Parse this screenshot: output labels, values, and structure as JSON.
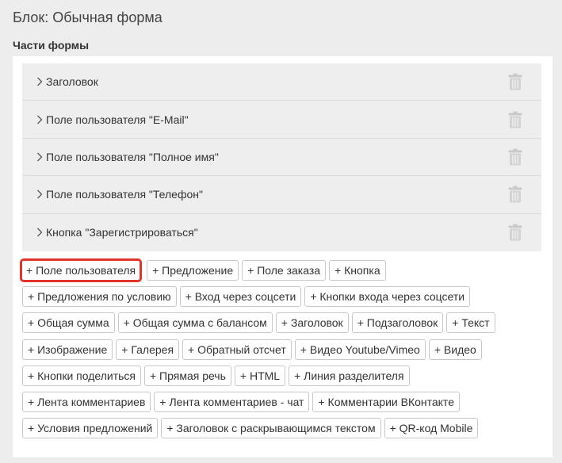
{
  "header": {
    "block_title": "Блок: Обычная форма",
    "section_title": "Части формы"
  },
  "parts": [
    {
      "label": "Заголовок"
    },
    {
      "label": "Поле пользователя \"E-Mail\""
    },
    {
      "label": "Поле пользователя \"Полное имя\""
    },
    {
      "label": "Поле пользователя \"Телефон\""
    },
    {
      "label": "Кнопка \"Зарегистрироваться\""
    }
  ],
  "icons": {
    "expand": "chevron-right-icon",
    "delete": "trash-icon"
  },
  "add_buttons": [
    [
      "+ Поле пользователя",
      "+ Предложение",
      "+ Поле заказа",
      "+ Кнопка"
    ],
    [
      "+ Предложения по условию",
      "+ Вход через соцсети",
      "+ Кнопки входа через соцсети"
    ],
    [
      "+ Общая сумма",
      "+ Общая сумма с балансом",
      "+ Заголовок",
      "+ Подзаголовок",
      "+ Текст"
    ],
    [
      "+ Изображение",
      "+ Галерея",
      "+ Обратный отсчет",
      "+ Видео Youtube/Vimeo",
      "+ Видео"
    ],
    [
      "+ Кнопки поделиться",
      "+ Прямая речь",
      "+ HTML",
      "+ Линия разделителя"
    ],
    [
      "+ Лента комментариев",
      "+ Лента комментариев - чат",
      "+ Комментарии ВКонтакте"
    ],
    [
      "+ Условия предложений",
      "+ Заголовок с раскрывающимся текстом",
      "+ QR-код Mobile"
    ]
  ],
  "colors": {
    "highlight": "#e0342c",
    "panel_bg": "#ffffff",
    "row_bg": "#eeeeee"
  }
}
